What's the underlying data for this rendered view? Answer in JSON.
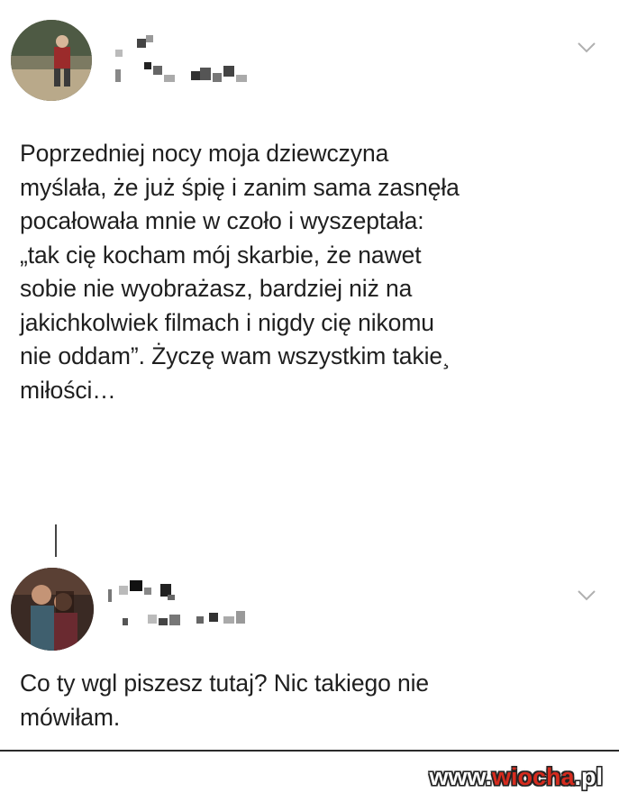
{
  "post": {
    "text": "Poprzedniej nocy moja dziewczyna\nmyślała, że już śpię i zanim sama zasnęła\npocałowała mnie w czoło i wyszeptała:\n„tak cię kocham mój skarbie, że nawet\nsobie nie wyobrażasz, bardziej niż na\njakichkolwiek filmach i nigdy cię nikomu\nnie oddam”. Życzę wam wszystkim takie¸\nmiłości…",
    "menu_icon": "chevron-down-icon"
  },
  "reply": {
    "text": "Co ty wgl piszesz tutaj? Nic takiego nie\nmówiłam.",
    "menu_icon": "chevron-down-icon"
  },
  "watermark": {
    "prefix": "www.",
    "accent": "wiocha",
    "suffix": ".pl"
  }
}
